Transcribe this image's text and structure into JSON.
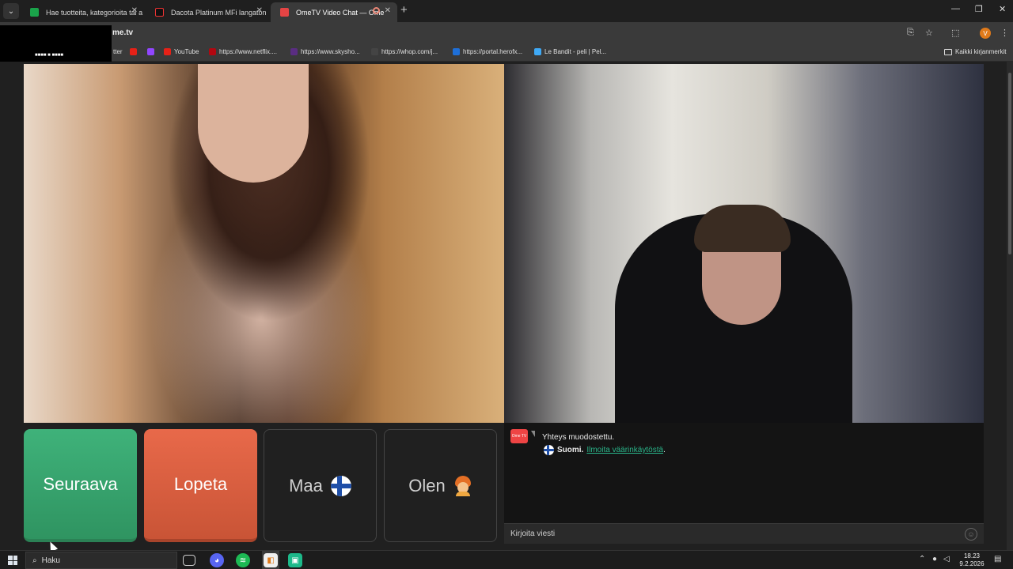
{
  "browser": {
    "tabs": [
      {
        "title": "Hae tuotteita, kategorioita tai a",
        "active": false,
        "favicon_color": "#1aa34a"
      },
      {
        "title": "Dacota Platinum MFi langaton",
        "active": false,
        "favicon_color": "#111111"
      },
      {
        "title": "OmeTV Video Chat — Ome",
        "active": true,
        "favicon_color": "#e44444"
      }
    ],
    "address": "me.tv",
    "profile_initial": "V",
    "bookmarks": [
      {
        "label": "tter",
        "favicon_color": "#333333"
      },
      {
        "label": "",
        "favicon_color": "#e62117"
      },
      {
        "label": "",
        "favicon_color": "#9146ff"
      },
      {
        "label": "YouTube",
        "favicon_color": "#e62117"
      },
      {
        "label": "https://www.netflix....",
        "favicon_color": "#b20710"
      },
      {
        "label": "https://www.skysho...",
        "favicon_color": "#5a2d82"
      },
      {
        "label": "https://whop.com/j...",
        "favicon_color": "#444444"
      },
      {
        "label": "https://portal.herofx...",
        "favicon_color": "#1e6fd8"
      },
      {
        "label": "Le Bandit - peli | Pel...",
        "favicon_color": "#3fa9f5"
      }
    ],
    "all_bookmarks": "Kaikki kirjanmerkit"
  },
  "popup": {
    "text": "■■■■ ■ ■■■■"
  },
  "controls": {
    "next_label": "Seuraava",
    "stop_label": "Lopeta",
    "country_label": "Maa",
    "gender_label": "Olen"
  },
  "chat": {
    "logo_text": "Ome TV",
    "status": "Yhteys muodostettu.",
    "country": "Suomi.",
    "report_link": "Ilmoita väärinkäytöstä",
    "report_suffix": ".",
    "input_placeholder": "Kirjoita viesti"
  },
  "taskbar": {
    "search_label": "Haku",
    "time": "18.23",
    "date": "9.2.2026"
  },
  "colors": {
    "next": "#35a56e",
    "stop": "#dc5f40",
    "link": "#2ab58a"
  }
}
